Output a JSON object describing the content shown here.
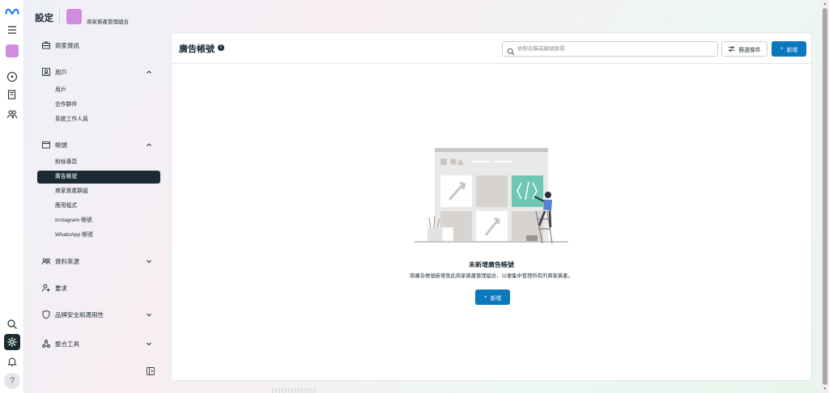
{
  "header": {
    "title": "設定",
    "business_name": "商家資產管理組合",
    "logo_color": "#d08de0"
  },
  "rail": {
    "icons": [
      "meta-logo-icon",
      "menu-icon",
      "business-avatar",
      "compass-icon",
      "pages-icon",
      "people-icon",
      "search-icon",
      "gear-icon",
      "bell-icon",
      "help-icon"
    ],
    "help_label": "?"
  },
  "sidebar": {
    "business_info": "商家資訊",
    "users": {
      "label": "用戶",
      "items": [
        "用戶",
        "合作夥伴",
        "系統工作人員"
      ]
    },
    "accounts": {
      "label": "帳號",
      "items": [
        "粉絲專頁",
        "廣告帳號",
        "商家資產群組",
        "應用程式",
        "Instagram 帳號",
        "WhatsApp 帳號"
      ],
      "active_index": 1
    },
    "data_sources": "資料來源",
    "requests": "要求",
    "brand_safety": "品牌安全和適用性",
    "integrations": "整合工具"
  },
  "main": {
    "title": "廣告帳號",
    "info_icon": "i",
    "search": {
      "placeholder": "依照名稱或編號搜尋",
      "value": ""
    },
    "filter_label": "篩選條件",
    "new_label": "新增",
    "empty_title": "未新增廣告帳號",
    "empty_description": "將廣告帳號新增至此商家資產管理組合，以便集中管理所有的商家資產。",
    "empty_button": "新增"
  },
  "colors": {
    "primary": "#0a78be",
    "active_nav": "#1c2b33",
    "text": "#1c2b33"
  }
}
